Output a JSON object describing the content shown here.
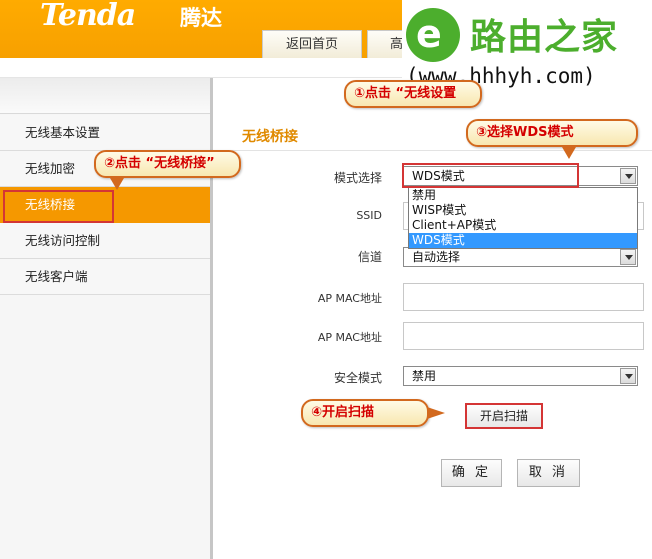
{
  "header": {
    "logo_text": "Tenda",
    "logo_cn": "腾达",
    "tabs": [
      {
        "label": "返回首页"
      },
      {
        "label": "高"
      }
    ]
  },
  "watermark": {
    "title": "路由之家",
    "url": "(www.hhhyh.com)"
  },
  "sidebar": {
    "items": [
      {
        "label": "无线基本设置",
        "active": false
      },
      {
        "label": "无线加密",
        "active": false
      },
      {
        "label": "无线桥接",
        "active": true
      },
      {
        "label": "无线访问控制",
        "active": false
      },
      {
        "label": "无线客户端",
        "active": false
      }
    ]
  },
  "main": {
    "title": "无线桥接",
    "fields": {
      "mode": {
        "label": "模式选择",
        "value": "WDS模式"
      },
      "ssid": {
        "label": "SSID",
        "value": ""
      },
      "channel": {
        "label": "信道",
        "value": "自动选择"
      },
      "ap_mac_1": {
        "label": "AP MAC地址",
        "value": ""
      },
      "ap_mac_2": {
        "label": "AP MAC地址",
        "value": ""
      },
      "security": {
        "label": "安全模式",
        "value": "禁用"
      }
    },
    "mode_options": [
      "禁用",
      "WISP模式",
      "Client+AP模式",
      "WDS模式"
    ],
    "selected_mode": "WDS模式",
    "scan_button": "开启扫描",
    "ok_button": "确 定",
    "cancel_button": "取 消"
  },
  "annotations": {
    "step1": "①点击 “无线设置",
    "step2": "②点击 “无线桥接”",
    "step3": "③选择WDS模式",
    "step4": "④开启扫描"
  },
  "colors": {
    "header_orange": "#f7a000",
    "active_item": "#f59800",
    "section_title": "#e08a00",
    "highlight_red": "#d43535",
    "callout_text": "#d40000",
    "dropdown_select": "#3399ff",
    "watermark_green": "#4cae2d"
  }
}
